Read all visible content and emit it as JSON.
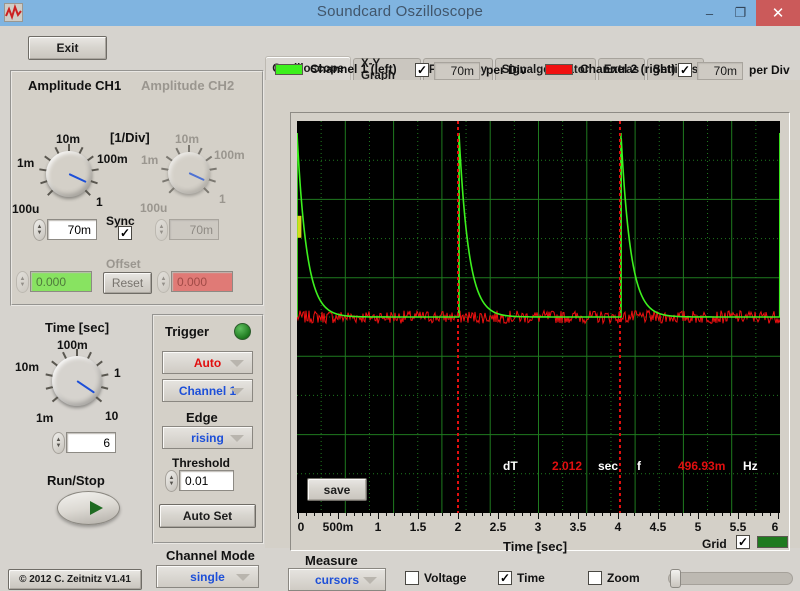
{
  "window": {
    "title": "Soundcard Oszilloscope",
    "minimize_label": "–",
    "maximize_label": "❐",
    "close_label": "✕",
    "titlebar_color": "#80b4e0",
    "close_color": "#cb5a5a"
  },
  "left": {
    "exit_label": "Exit",
    "copyright": "© 2012  C. Zeitnitz V1.41",
    "channel_mode": {
      "label": "Channel Mode",
      "value": "single"
    },
    "amplitude": {
      "ch1_title": "Amplitude CH1",
      "ch2_title": "Amplitude CH2",
      "per_div_label": "[1/Div]",
      "ch1_ticks": [
        "1m",
        "10m",
        "100m",
        "1",
        "100u"
      ],
      "ch2_ticks": [
        "1m",
        "10m",
        "100m",
        "1",
        "100u"
      ],
      "ch1_value": "70m",
      "ch2_value": "70m",
      "sync_label": "Sync",
      "sync_checked": true,
      "offset_label": "Offset",
      "offset_ch1": "0.000",
      "offset_ch2": "0.000",
      "reset_label": "Reset",
      "ch1_color": "#88e361",
      "ch2_color": "#e07a76"
    },
    "time": {
      "title": "Time [sec]",
      "ticks": [
        "10m",
        "100m",
        "1",
        "1m",
        "10"
      ],
      "value": "6",
      "runstop_label": "Run/Stop"
    },
    "trigger": {
      "title": "Trigger",
      "led_color": "#1f7a1f",
      "mode": "Auto",
      "mode_color": "#e10f0f",
      "source": "Channel 1",
      "source_color": "#1d4fd8",
      "edge_label": "Edge",
      "edge": "rising",
      "threshold_label": "Threshold",
      "threshold": "0.01",
      "autoset_label": "Auto Set"
    }
  },
  "tabs": [
    {
      "label": "Oscilloscope",
      "active": true
    },
    {
      "label": "X-Y Graph",
      "active": false
    },
    {
      "label": "Frequency",
      "active": false
    },
    {
      "label": "Signalgenerator",
      "active": false
    },
    {
      "label": "Extras",
      "active": false
    },
    {
      "label": "Settings",
      "active": false
    }
  ],
  "channels": [
    {
      "name": "Channel 1 (left)",
      "color": "#3df01e",
      "enabled": true,
      "per_div": "70m",
      "per_div_label": "per Div"
    },
    {
      "name": "Channel 2 (right)",
      "color": "#f01010",
      "enabled": true,
      "per_div": "70m",
      "per_div_label": "per Div"
    }
  ],
  "scope": {
    "save_label": "save",
    "grid_label": "Grid",
    "grid_checked": true,
    "grid_color": "#1f7a1f",
    "readout": {
      "dt_label": "dT",
      "dt_value": "2.012",
      "dt_unit": "sec",
      "f_label": "f",
      "f_value": "496.93m",
      "f_unit": "Hz"
    }
  },
  "measure": {
    "label": "Measure",
    "mode": "cursors",
    "voltage_label": "Voltage",
    "voltage_checked": false,
    "time_label": "Time",
    "time_checked": true,
    "zoom_label": "Zoom",
    "zoom_checked": false
  },
  "chart_data": {
    "type": "line",
    "title": "",
    "xlabel": "Time [sec]",
    "ylabel": "",
    "xlim": [
      0,
      6
    ],
    "ylim": [
      -0.245,
      0.245
    ],
    "grid": true,
    "xticks": [
      0,
      0.5,
      1,
      1.5,
      2,
      2.5,
      3,
      3.5,
      4,
      4.5,
      5,
      5.5,
      6
    ],
    "xticklabels": [
      "0",
      "500m",
      "1",
      "1.5",
      "2",
      "2.5",
      "3",
      "3.5",
      "4",
      "4.5",
      "5",
      "5.5",
      "6"
    ],
    "cursors": [
      {
        "name": "cursor-1",
        "x": 2.0,
        "color": "#e10f0f"
      },
      {
        "name": "cursor-2",
        "x": 4.012,
        "color": "#e10f0f"
      }
    ],
    "series": [
      {
        "name": "Channel 1 (left)",
        "color": "#3df01e",
        "description": "Decaying exponential pulses repeating every ~2.012 s (f = 496.93 mHz)",
        "pulse_times": [
          0.0,
          2.012,
          4.024,
          6.0
        ],
        "pulse_peak": 0.23,
        "decay_tau": 0.12,
        "baseline": 0.0
      },
      {
        "name": "Channel 2 (right)",
        "color": "#f01010",
        "description": "Low-level noise around baseline",
        "pulse_times": [],
        "pulse_peak": 0.01,
        "baseline": 0.0
      }
    ]
  }
}
